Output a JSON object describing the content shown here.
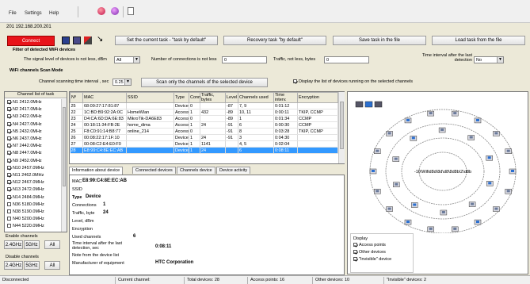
{
  "menu": {
    "file": "File",
    "settings": "Settings",
    "help": "Help"
  },
  "address": "201 192.168.200.201",
  "toolbar": {
    "connect_label": "Connect",
    "set_task": "Set the current task - \"task by default\"",
    "recovery_task": "Recovery task \"by default\"",
    "save_task": "Save task in the file",
    "load_task": "Load task from the file"
  },
  "filter": {
    "title": "Filter of detected WiFi devices",
    "signal_label": "The signal level of devices is not less, dBm",
    "signal_value": "All",
    "connections_label": "Number of connections is not less",
    "connections_value": "0",
    "traffic_label": "Traffic, not less, bytes",
    "traffic_value": "0",
    "interval_label_1": "Time interval after the last",
    "interval_label_2": "detection",
    "interval_value": "No"
  },
  "scan": {
    "title": "WiFi channels Scan Mode",
    "time_label": "Channel scanning time interval , sec",
    "time_value": "0.25",
    "scan_selected_button": "Scan only the channels of the selected device",
    "display_running_label": "Display the list of devices running on the selected channels"
  },
  "channels": {
    "header": "Channel list of task",
    "items": [
      {
        "label": "N1  2412.0MHz",
        "checked": true
      },
      {
        "label": "N2  2417.0MHz",
        "checked": true
      },
      {
        "label": "N3  2422.0MHz",
        "checked": true
      },
      {
        "label": "N4  2427.0MHz",
        "checked": true
      },
      {
        "label": "N5  2432.0MHz",
        "checked": true
      },
      {
        "label": "N6  2437.0MHz",
        "checked": true
      },
      {
        "label": "N7  2442.0MHz",
        "checked": true
      },
      {
        "label": "N8  2447.0MHz",
        "checked": true
      },
      {
        "label": "N9  2452.0MHz",
        "checked": true
      },
      {
        "label": "N10  2457.0MHz",
        "checked": true
      },
      {
        "label": "N11  2462.0MHz",
        "checked": true
      },
      {
        "label": "N12  2467.0MHz",
        "checked": true
      },
      {
        "label": "N13  2472.0MHz",
        "checked": true
      },
      {
        "label": "N14  2484.0MHz",
        "checked": true
      },
      {
        "label": "N36  5180.0MHz",
        "checked": false
      },
      {
        "label": "N38  5190.0MHz",
        "checked": false
      },
      {
        "label": "N40  5200.0MHz",
        "checked": false
      },
      {
        "label": "N44  5220.0MHz",
        "checked": false
      }
    ],
    "enable_label": "Enable channels",
    "disable_label": "Disable channels",
    "btn_24": "2.4GHz",
    "btn_5": "5GHz",
    "btn_all": "All"
  },
  "devices": {
    "columns": [
      "Nº",
      "MAC",
      "SSID",
      "Type",
      "Conn",
      "Traffic, bytes",
      "Level",
      "Channels used",
      "Time interv.",
      "Encryption"
    ],
    "rows": [
      [
        "25",
        "68:09:27:17:81:87",
        "",
        "Device",
        "0",
        "",
        "-87",
        "7, 9",
        "0:01:12",
        ""
      ],
      [
        "22",
        "1C:BD:B9:92:2A:0C",
        "HomeWlan",
        "Access",
        "1",
        "432",
        "-89",
        "10, 11",
        "0:00:11",
        "TKIP, CCMP"
      ],
      [
        "23",
        "D4:CA:6D:DA:6E:83",
        "MikroTik-DA6E83",
        "Access",
        "0",
        "",
        "-89",
        "1",
        "0:01:34",
        "CCMP"
      ],
      [
        "24",
        "00:18:11:34:FB:2E",
        "home_dima",
        "Access",
        "1",
        "24",
        "-91",
        "6",
        "0:00:30",
        "CCMP"
      ],
      [
        "25",
        "F8:C0:91:14:B8:77",
        "online_214",
        "Access",
        "0",
        "",
        "-91",
        "8",
        "0:03:28",
        "TKIP, CCMP"
      ],
      [
        "26",
        "00:08:22:17:1F:10",
        "",
        "Device",
        "1",
        "24",
        "-91",
        "3",
        "0:04:30",
        ""
      ],
      [
        "27",
        "00:08:C2:E4:E0:F0",
        "",
        "Device",
        "1",
        "1141",
        "",
        "4, 5",
        "0:02:04",
        ""
      ],
      [
        "28",
        "E8:99:C4:8E:EC:AB",
        "",
        "Device",
        "1",
        "24",
        "",
        "6",
        "0:08:11",
        ""
      ]
    ],
    "selected_row": 7
  },
  "info": {
    "tabs": [
      "Information about device",
      "Connected devices",
      "Channels device",
      "Device activity"
    ],
    "mac_label": "MAC",
    "mac_value": "E8:99:C4:8E:EC:AB",
    "ssid_label": "SSID",
    "type_label": "Type",
    "type_value": "Device",
    "connections_label": "Connections",
    "connections_value": "1",
    "traffic_label": "Traffic, byte",
    "traffic_value": "24",
    "level_label": "Level, dBm",
    "encryption_label": "Encryption",
    "channels_label": "Used channels",
    "channels_value": "6",
    "interval_label_1": "Time interval after the last",
    "interval_label_2": "detection, sec",
    "interval_value": "0:08:11",
    "note_label": "Note from the device list",
    "manufacturer_label": "Manufacturer of equipment",
    "manufacturer_value": "HTC Corporation"
  },
  "map": {
    "center_label": "-10\\Wifid8d\\8d\\d8\\8d8b\\2\\d8b"
  },
  "display": {
    "title": "Display",
    "items": [
      {
        "label": "Access points",
        "checked": true
      },
      {
        "label": "Other devices",
        "checked": true
      },
      {
        "label": "\"Invisible\" device",
        "checked": true
      }
    ]
  },
  "status": {
    "state": "Disconnected",
    "current_channel": "Current channel:",
    "total": "Total devices: 28",
    "access_points": "Access points: 16",
    "other": "Other devices: 10",
    "invisible": "\"Invisible\" devices: 2"
  },
  "colors": {
    "connect_bg": "#e8141a",
    "selected_row": "#3399ff",
    "ring": "#888888"
  }
}
